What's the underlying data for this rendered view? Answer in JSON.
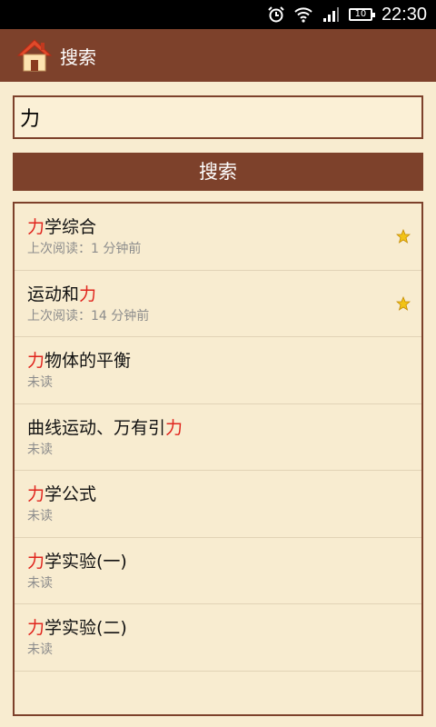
{
  "status": {
    "time": "22:30",
    "battery": "10"
  },
  "appbar": {
    "title": "搜索"
  },
  "search": {
    "value": "力",
    "button": "搜索"
  },
  "results": [
    {
      "pre": "",
      "hl": "力",
      "post": "学综合",
      "sub": "上次阅读：1 分钟前",
      "star": true
    },
    {
      "pre": "运动和",
      "hl": "力",
      "post": "",
      "sub": "上次阅读：14 分钟前",
      "star": true
    },
    {
      "pre": "",
      "hl": "力",
      "post": "物体的平衡",
      "sub": "未读",
      "star": false
    },
    {
      "pre": "曲线运动、万有引",
      "hl": "力",
      "post": "",
      "sub": "未读",
      "star": false
    },
    {
      "pre": "",
      "hl": "力",
      "post": "学公式",
      "sub": "未读",
      "star": false
    },
    {
      "pre": "",
      "hl": "力",
      "post": "学实验(一)",
      "sub": "未读",
      "star": false
    },
    {
      "pre": "",
      "hl": "力",
      "post": "学实验(二)",
      "sub": "未读",
      "star": false
    }
  ],
  "colors": {
    "brand": "#7d412b",
    "background": "#f8ecd0",
    "highlight": "#e0241c",
    "star": "#f2c316"
  },
  "icons": [
    "alarm-icon",
    "wifi-icon",
    "signal-icon",
    "battery-icon",
    "home-icon",
    "star-icon"
  ]
}
